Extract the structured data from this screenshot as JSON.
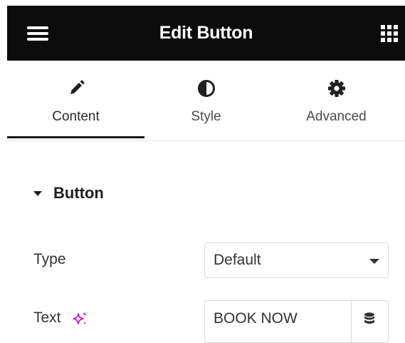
{
  "header": {
    "title": "Edit Button",
    "menu_icon": "hamburger-menu-icon",
    "apps_icon": "grid-apps-icon",
    "background": "#0c0c0c"
  },
  "tabs": [
    {
      "label": "Content",
      "icon": "pencil-icon",
      "active": true
    },
    {
      "label": "Style",
      "icon": "half-circle-contrast-icon",
      "active": false
    },
    {
      "label": "Advanced",
      "icon": "gear-icon",
      "active": false
    }
  ],
  "section": {
    "title": "Button",
    "expanded": true
  },
  "controls": {
    "type": {
      "label": "Type",
      "value": "Default"
    },
    "text": {
      "label": "Text",
      "value": "BOOK NOW",
      "ai_icon": "sparkle-ai-icon",
      "dynamic_icon": "database-icon",
      "ai_color": "#d004d4"
    }
  }
}
